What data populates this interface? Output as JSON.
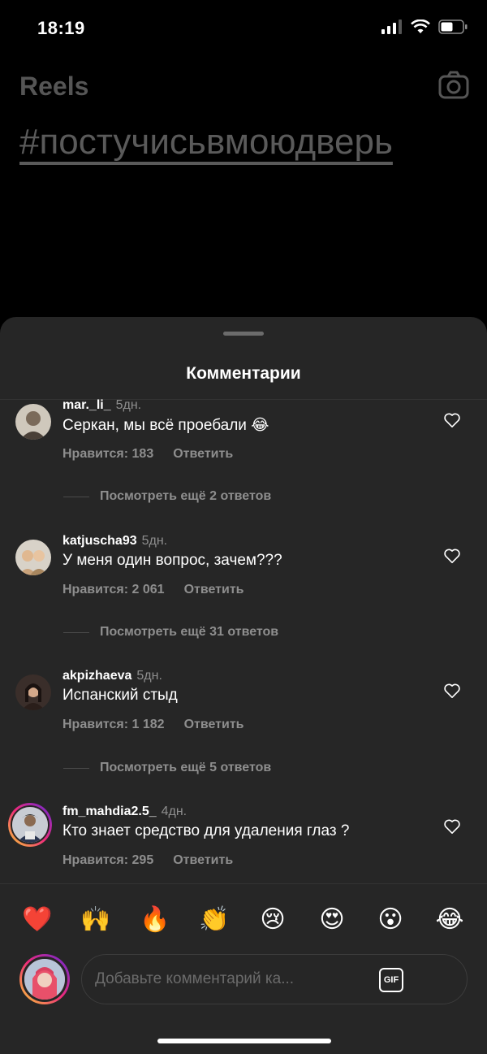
{
  "status_bar": {
    "time": "18:19"
  },
  "background": {
    "title": "Reels",
    "hashtag": "#постучисьвмоюдверь"
  },
  "sheet": {
    "title": "Комментарии"
  },
  "comments": [
    {
      "username": "mar._li_",
      "date": "5дн.",
      "text": "Серкан, мы всё проебали 😂",
      "likes": "Нравится: 183",
      "reply": "Ответить",
      "avatar_color": "#7a6a5a"
    },
    {
      "username": "katjuscha93",
      "date": "5дн.",
      "text": "У меня один вопрос, зачем???",
      "likes": "Нравится: 2 061",
      "reply": "Ответить",
      "avatar_color": "#b59a7a"
    },
    {
      "username": "akpizhaeva",
      "date": "5дн.",
      "text": "Испанский стыд",
      "likes": "Нравится: 1 182",
      "reply": "Ответить",
      "avatar_color": "#5a4038"
    },
    {
      "username": "fm_mahdia2.5_",
      "date": "4дн.",
      "text": "Кто знает средство для удаления глаз ?",
      "likes": "Нравится: 295",
      "reply": "Ответить",
      "avatar_color": "#8a8fa0"
    }
  ],
  "view_more": [
    "Посмотреть ещё 2 ответов",
    "Посмотреть ещё 31 ответов",
    "Посмотреть ещё 5 ответов"
  ],
  "emoji_bar": [
    "❤️",
    "🙌",
    "🔥",
    "👏",
    "😢",
    "😍",
    "😮",
    "😂"
  ],
  "composer": {
    "placeholder": "Добавьте комментарий ка...",
    "gif_label": "GIF"
  },
  "colors": {
    "sheet_bg": "#262626",
    "secondary_text": "#8e8e8e",
    "accent_gradient": [
      "#f9ce34",
      "#ee2a7b",
      "#6228d7"
    ]
  }
}
